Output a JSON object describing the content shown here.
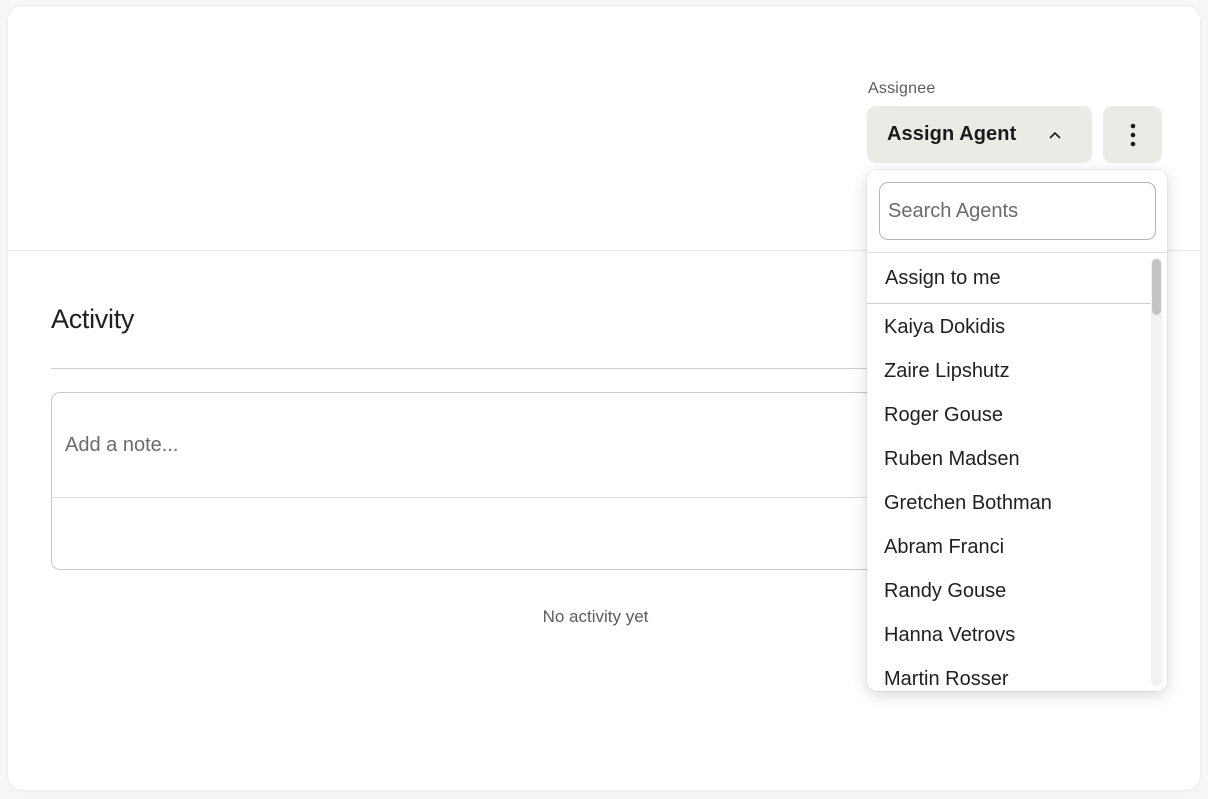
{
  "assignee": {
    "label": "Assignee",
    "button_label": "Assign Agent",
    "chevron_icon": "chevron-up-icon",
    "more_icon": "more-vertical-icon"
  },
  "activity": {
    "title": "Activity",
    "note_placeholder": "Add a note...",
    "empty_text": "No activity yet"
  },
  "dropdown": {
    "search_placeholder": "Search Agents",
    "assign_to_me": "Assign to me",
    "agents": [
      "Kaiya Dokidis",
      "Zaire Lipshutz",
      "Roger Gouse",
      "Ruben Madsen",
      "Gretchen Bothman",
      "Abram Franci",
      "Randy Gouse",
      "Hanna Vetrovs",
      "Martin Rosser"
    ]
  },
  "colors": {
    "button_bg": "#ebebe6",
    "text": "#1f1f1f",
    "muted_text": "#5c5c5c"
  }
}
